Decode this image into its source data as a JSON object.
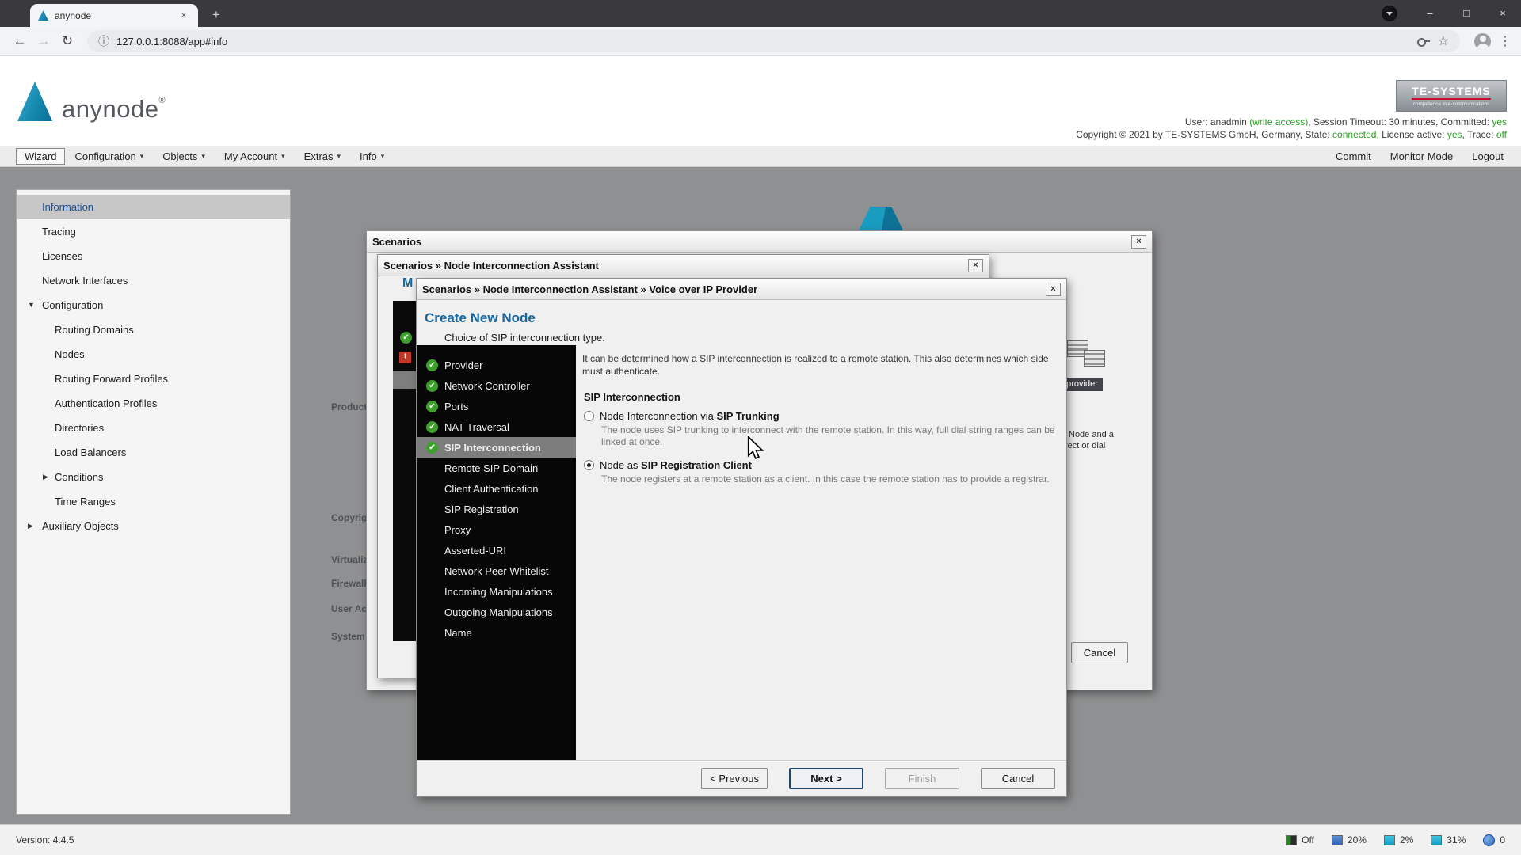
{
  "browser": {
    "tab_title": "anynode",
    "url": "127.0.0.1:8088/app#info"
  },
  "icons": {
    "close": "×",
    "minimize": "–",
    "maximize": "□",
    "new_tab": "+",
    "back": "←",
    "forward": "→",
    "reload": "↻",
    "info": "ⓘ",
    "star": "☆",
    "menu_dots": "⋮",
    "caret": "▾",
    "expand_down": "▼",
    "expand_right": "▶",
    "check": "✔"
  },
  "header": {
    "logo_text": "anynode",
    "logo_reg": "®",
    "te_title": "TE-SYSTEMS",
    "te_subtitle": "competence in e-communications",
    "info_line1": {
      "s1": "User: anadmin ",
      "s2": "(write access)",
      "s3": ", Session Timeout: 30 minutes, Committed: ",
      "s4": "yes"
    },
    "info_line2": {
      "s1": "Copyright © 2021 by TE-SYSTEMS GmbH, Germany, State: ",
      "s2": "connected",
      "s3": ", License active: ",
      "s4": "yes",
      "s5": ", Trace: ",
      "s6": "off"
    }
  },
  "menubar": {
    "items": [
      {
        "label": "Wizard"
      },
      {
        "label": "Configuration"
      },
      {
        "label": "Objects"
      },
      {
        "label": "My Account"
      },
      {
        "label": "Extras"
      },
      {
        "label": "Info"
      }
    ],
    "right": [
      {
        "label": "Commit"
      },
      {
        "label": "Monitor Mode"
      },
      {
        "label": "Logout"
      }
    ]
  },
  "sidebar": {
    "items": [
      {
        "label": "Information"
      },
      {
        "label": "Tracing"
      },
      {
        "label": "Licenses"
      },
      {
        "label": "Network Interfaces"
      },
      {
        "label": "Configuration"
      },
      {
        "label": "Routing Domains"
      },
      {
        "label": "Nodes"
      },
      {
        "label": "Routing Forward Profiles"
      },
      {
        "label": "Authentication Profiles"
      },
      {
        "label": "Directories"
      },
      {
        "label": "Load Balancers"
      },
      {
        "label": "Conditions"
      },
      {
        "label": "Time Ranges"
      },
      {
        "label": "Auxiliary Objects"
      }
    ]
  },
  "background": {
    "page_labels": [
      "Product",
      "Copyrig",
      "Virtualiz",
      "Firewall",
      "User Ac",
      "System"
    ]
  },
  "dialog_back": {
    "title": "Scenarios",
    "provider_label": "provider",
    "fragment1": "Node and a",
    "fragment2": "rect or dial",
    "cancel": "Cancel"
  },
  "dialog_mid": {
    "breadcrumb": "Scenarios » Node Interconnection Assistant",
    "fragment_title": "M",
    "error_mark": "!"
  },
  "dialog": {
    "breadcrumb": "Scenarios » Node Interconnection Assistant » Voice over IP Provider",
    "title": "Create New Node",
    "subtitle": "Choice of SIP interconnection type.",
    "steps": [
      {
        "label": "Provider",
        "status": "done"
      },
      {
        "label": "Network Controller",
        "status": "done"
      },
      {
        "label": "Ports",
        "status": "done"
      },
      {
        "label": "NAT Traversal",
        "status": "done"
      },
      {
        "label": "SIP Interconnection",
        "status": "current"
      },
      {
        "label": "Remote SIP Domain",
        "status": "pending"
      },
      {
        "label": "Client Authentication",
        "status": "pending"
      },
      {
        "label": "SIP Registration",
        "status": "pending"
      },
      {
        "label": "Proxy",
        "status": "pending"
      },
      {
        "label": "Asserted-URI",
        "status": "pending"
      },
      {
        "label": "Network Peer Whitelist",
        "status": "pending"
      },
      {
        "label": "Incoming Manipulations",
        "status": "pending"
      },
      {
        "label": "Outgoing Manipulations",
        "status": "pending"
      },
      {
        "label": "Name",
        "status": "pending"
      }
    ],
    "intro": "It can be determined how a SIP interconnection is realized to a remote station. This also determines which side must authenticate.",
    "section": "SIP Interconnection",
    "option1_prefix": "Node Interconnection via ",
    "option1_bold": "SIP Trunking",
    "option1_desc": "The node uses SIP trunking to interconnect with the remote station. In this way, full dial string ranges can be linked at once.",
    "option2_prefix": "Node as ",
    "option2_bold": "SIP Registration Client",
    "option2_desc": "The node registers at a remote station as a client. In this case the remote station has to provide a registrar.",
    "buttons": {
      "previous": "< Previous",
      "next": "Next >",
      "finish": "Finish",
      "cancel": "Cancel"
    }
  },
  "statusbar": {
    "version": "Version: 4.4.5",
    "tray": [
      {
        "label": "Off"
      },
      {
        "label": "20%"
      },
      {
        "label": "2%"
      },
      {
        "label": "31%"
      },
      {
        "label": "0"
      }
    ]
  },
  "colors": {
    "accent_blue": "#1766a0",
    "status_green": "#2e9e27",
    "logo_teal": "#1589ad"
  }
}
